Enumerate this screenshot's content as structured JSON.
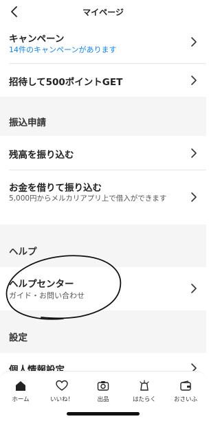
{
  "header": {
    "title": "マイページ"
  },
  "rows": {
    "campaign": {
      "title": "キャンペーン",
      "sub": "14件のキャンペーンがあります"
    },
    "invite": {
      "title": "招待して500ポイントGET"
    },
    "transfer_balance": {
      "title": "残高を振り込む"
    },
    "borrow": {
      "title": "お金を借りて振り込む",
      "sub": "5,000円からメルカリアプリ上で借入ができます"
    },
    "help_center": {
      "title": "ヘルプセンター",
      "sub": "ガイド・お問い合わせ"
    },
    "privacy": {
      "title": "個人情報設定"
    }
  },
  "sections": {
    "transfer": "振込申請",
    "help": "ヘルプ",
    "settings": "設定"
  },
  "tabs": [
    {
      "label": "ホーム",
      "icon": "home-icon"
    },
    {
      "label": "いいね！",
      "icon": "heart-icon"
    },
    {
      "label": "出品",
      "icon": "camera-icon"
    },
    {
      "label": "はたらく",
      "icon": "work-icon"
    },
    {
      "label": "おさいふ",
      "icon": "wallet-icon"
    }
  ],
  "colors": {
    "accent_blue": "#0a83ff",
    "section_bg": "#f5f5f5"
  }
}
